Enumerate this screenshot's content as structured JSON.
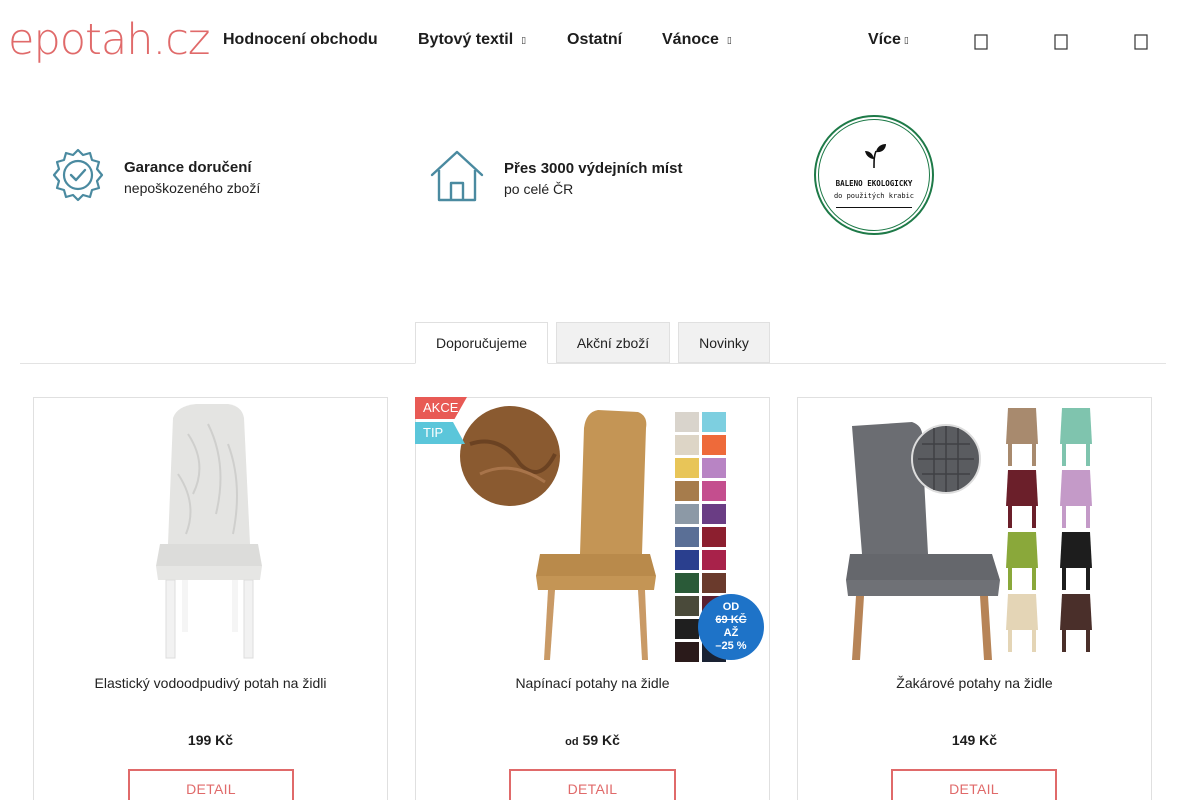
{
  "brand": {
    "logo_text": "epotah.cz",
    "accent_color": "#e06a6a"
  },
  "nav": {
    "items": [
      {
        "label": "Hodnocení obchodu",
        "has_dropdown": false
      },
      {
        "label": "Bytový textil",
        "has_dropdown": true
      },
      {
        "label": "Ostatní",
        "has_dropdown": false
      },
      {
        "label": "Vánoce",
        "has_dropdown": true
      },
      {
        "label": "Více",
        "has_dropdown": true
      }
    ],
    "caret": "▯",
    "icons": [
      "search-icon",
      "user-icon",
      "cart-icon"
    ]
  },
  "benefits": [
    {
      "title": "Garance doručení",
      "subtitle": "nepoškozeného zboží",
      "icon": "badge-check-icon",
      "icon_color": "#4a8aa0"
    },
    {
      "title": "Přes 3000 výdejních míst",
      "subtitle": "po celé ČR",
      "icon": "home-icon",
      "icon_color": "#4a8aa0"
    }
  ],
  "eco_badge": {
    "line1": "BALENO EKOLOGICKY",
    "line2": "do použitých krabic",
    "color": "#1e7a48"
  },
  "tabs": [
    {
      "label": "Doporučujeme",
      "active": true
    },
    {
      "label": "Akční zboží",
      "active": false
    },
    {
      "label": "Novinky",
      "active": false
    }
  ],
  "products": [
    {
      "name": "Elastický vodoodpudivý potah na židli",
      "price_prefix": "",
      "price": "199 Kč",
      "button": "DETAIL"
    },
    {
      "name": "Napínací potahy na židle",
      "price_prefix": "od",
      "price": "59 Kč",
      "button": "DETAIL",
      "flags": [
        "AKCE",
        "TIP"
      ],
      "discount": {
        "line1": "OD",
        "line2": "69 KČ",
        "line3": "AŽ",
        "line4": "–25 %"
      }
    },
    {
      "name": "Žakárové potahy na židle",
      "price_prefix": "",
      "price": "149 Kč",
      "button": "DETAIL"
    }
  ],
  "colors": {
    "flag_akce": "#e85a55",
    "flag_tip": "#5bc6da",
    "discount_badge": "#1e73c8"
  }
}
